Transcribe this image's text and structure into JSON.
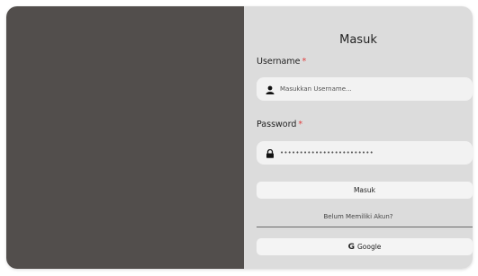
{
  "login": {
    "title": "Masuk",
    "username_label": "Username",
    "username_placeholder": "Masukkan Username...",
    "password_label": "Password",
    "password_value": "••••••••••••••••••••••••",
    "required_mark": "*",
    "submit_label": "Masuk",
    "signup_prompt": "Belum Memiliki Akun?",
    "google_label": "Google",
    "google_logo_letter": "G"
  },
  "colors": {
    "left_panel": "#524e4c",
    "right_panel": "#dcdcdc",
    "required": "#e04040"
  },
  "icons": {
    "username": "user-icon",
    "password": "lock-icon",
    "google": "google-icon"
  }
}
